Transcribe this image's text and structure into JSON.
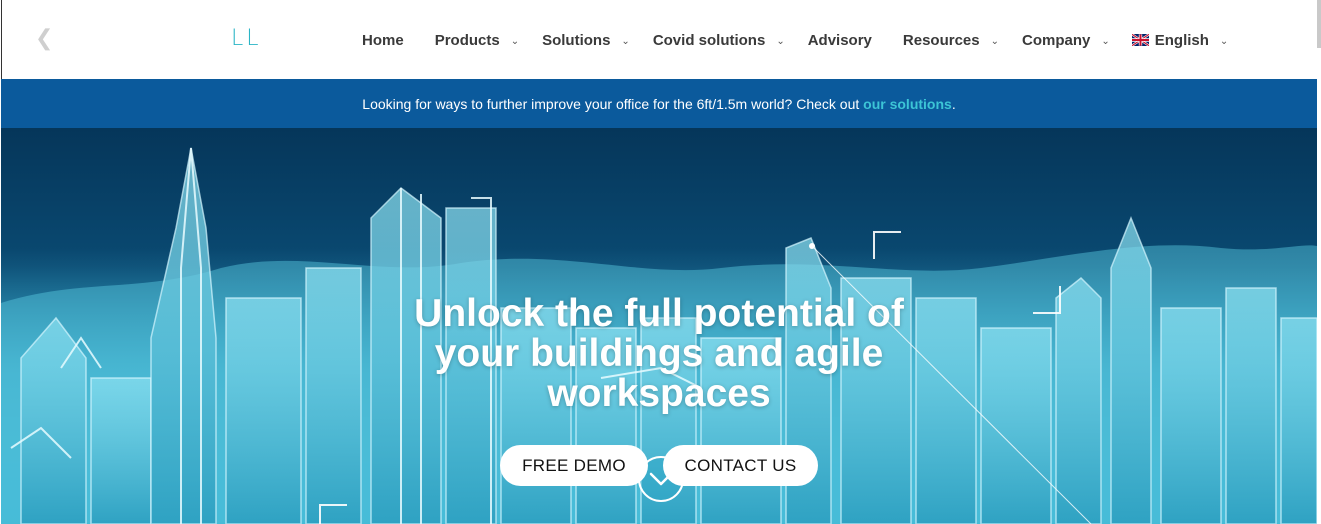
{
  "header": {
    "back_glyph": "❮",
    "logo_text": "LL",
    "nav": [
      {
        "label": "Home",
        "has_dropdown": false
      },
      {
        "label": "Products",
        "has_dropdown": true
      },
      {
        "label": "Solutions",
        "has_dropdown": true
      },
      {
        "label": "Covid solutions",
        "has_dropdown": true
      },
      {
        "label": "Advisory",
        "has_dropdown": false
      },
      {
        "label": "Resources",
        "has_dropdown": true
      },
      {
        "label": "Company",
        "has_dropdown": true
      },
      {
        "label": "English",
        "has_dropdown": true,
        "icon": "uk-flag-icon"
      }
    ],
    "chevron_glyph": "⌄"
  },
  "announcement": {
    "text": "Looking for ways to further improve your office for the 6ft/1.5m world? Check out ",
    "link_text": "our solutions",
    "suffix": "."
  },
  "hero": {
    "title_lines": [
      "Unlock the full potential of",
      "your buildings and agile",
      "workspaces"
    ],
    "buttons": {
      "demo": "FREE DEMO",
      "contact": "CONTACT US"
    },
    "scroll_icon": "chevron-down-circle-icon"
  },
  "colors": {
    "accent": "#2bb5c6",
    "announce_bg": "#0b5a9c",
    "link": "#3cc5d6",
    "hero_dark": "#05365a",
    "hero_light": "#2aa6c6"
  }
}
